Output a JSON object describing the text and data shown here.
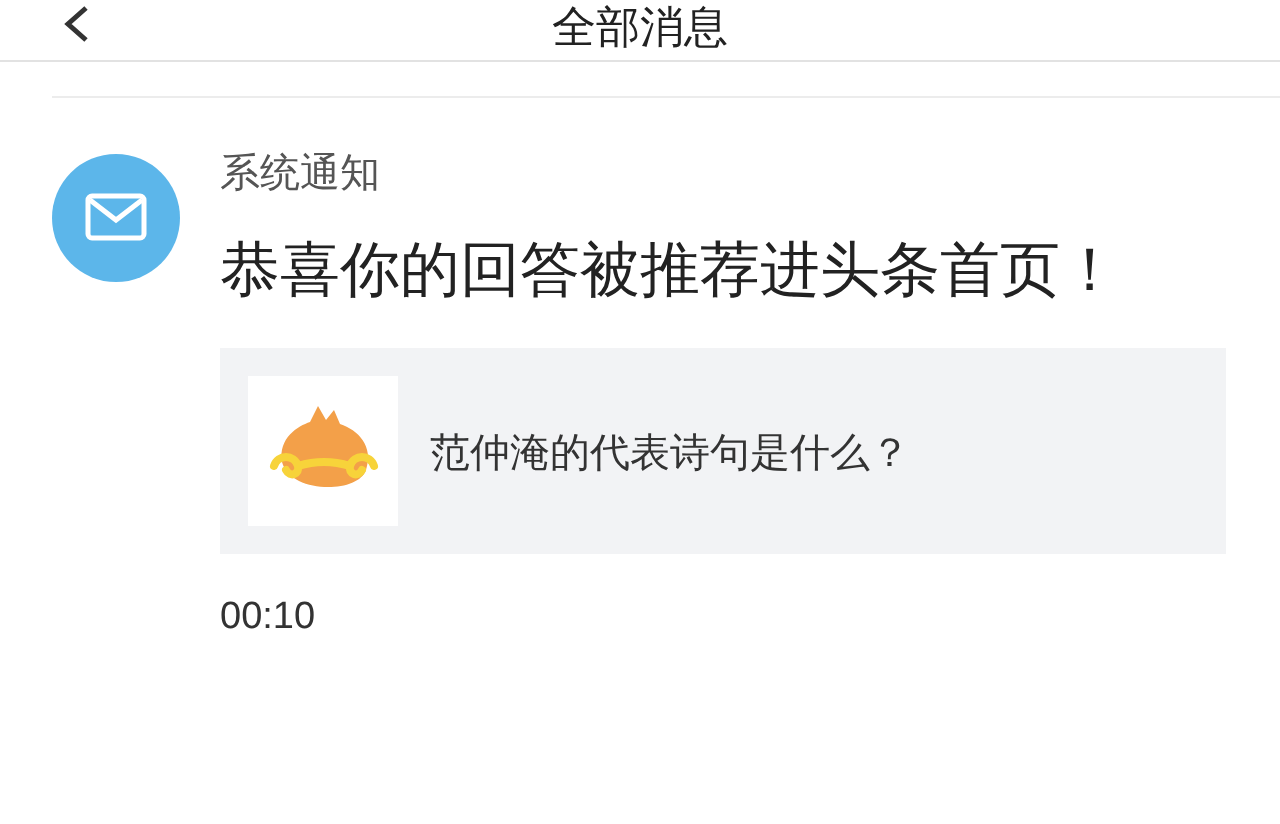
{
  "header": {
    "title": "全部消息"
  },
  "message": {
    "sender": "系统通知",
    "text": "恭喜你的回答被推荐进头条首页！",
    "card": {
      "title": "范仲淹的代表诗句是什么？"
    },
    "time": "00:10"
  }
}
